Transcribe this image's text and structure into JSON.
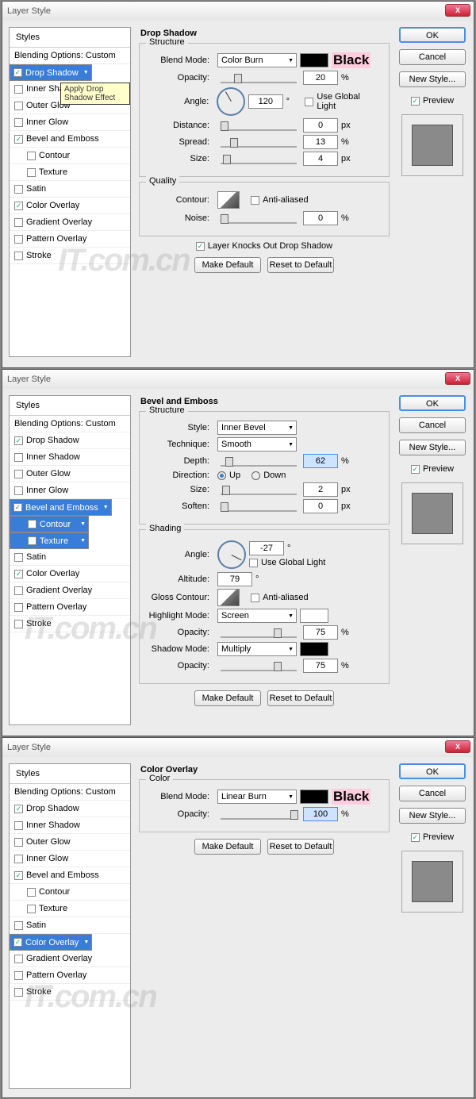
{
  "common": {
    "title": "Layer Style",
    "stylesHeader": "Styles",
    "blending": "Blending Options: Custom",
    "ok": "OK",
    "cancel": "Cancel",
    "newStyle": "New Style...",
    "preview": "Preview",
    "makeDefault": "Make Default",
    "resetDefault": "Reset to Default",
    "close": "X"
  },
  "styleList": [
    {
      "label": "Drop Shadow",
      "chk": true
    },
    {
      "label": "Inner Shadow",
      "chk": false
    },
    {
      "label": "Outer Glow",
      "chk": false
    },
    {
      "label": "Inner Glow",
      "chk": false
    },
    {
      "label": "Bevel and Emboss",
      "chk": true
    },
    {
      "label": "Contour",
      "chk": false,
      "sub": true
    },
    {
      "label": "Texture",
      "chk": false,
      "sub": true
    },
    {
      "label": "Satin",
      "chk": false
    },
    {
      "label": "Color Overlay",
      "chk": true
    },
    {
      "label": "Gradient Overlay",
      "chk": false
    },
    {
      "label": "Pattern Overlay",
      "chk": false
    },
    {
      "label": "Stroke",
      "chk": false
    }
  ],
  "d1": {
    "title": "Drop Shadow",
    "struct": "Structure",
    "quality": "Quality",
    "blendMode": "Blend Mode:",
    "blendVal": "Color Burn",
    "colorTag": "Black",
    "opacity": "Opacity:",
    "opacityVal": "20",
    "angle": "Angle:",
    "angleVal": "120",
    "globalLight": "Use Global Light",
    "distance": "Distance:",
    "distanceVal": "0",
    "spread": "Spread:",
    "spreadVal": "13",
    "size": "Size:",
    "sizeVal": "4",
    "contour": "Contour:",
    "antiAliased": "Anti-aliased",
    "noise": "Noise:",
    "noiseVal": "0",
    "knockout": "Layer Knocks Out Drop Shadow",
    "tooltip": "Apply Drop Shadow Effect",
    "px": "px",
    "pct": "%",
    "deg": "°"
  },
  "d2": {
    "title": "Bevel and Emboss",
    "struct": "Structure",
    "shading": "Shading",
    "style": "Style:",
    "styleVal": "Inner Bevel",
    "technique": "Technique:",
    "techniqueVal": "Smooth",
    "depth": "Depth:",
    "depthVal": "62",
    "direction": "Direction:",
    "up": "Up",
    "down": "Down",
    "size": "Size:",
    "sizeVal": "2",
    "soften": "Soften:",
    "softenVal": "0",
    "angle": "Angle:",
    "angleVal": "-27",
    "globalLight": "Use Global Light",
    "altitude": "Altitude:",
    "altitudeVal": "79",
    "contour": "Gloss Contour:",
    "antiAliased": "Anti-aliased",
    "hlMode": "Highlight Mode:",
    "hlVal": "Screen",
    "hlOp": "Opacity:",
    "hlOpVal": "75",
    "shMode": "Shadow Mode:",
    "shVal": "Multiply",
    "shOp": "Opacity:",
    "shOpVal": "75",
    "px": "px",
    "pct": "%",
    "deg": "°"
  },
  "d3": {
    "title": "Color Overlay",
    "color": "Color",
    "blendMode": "Blend Mode:",
    "blendVal": "Linear Burn",
    "colorTag": "Black",
    "opacity": "Opacity:",
    "opacityVal": "100",
    "pct": "%"
  },
  "wm": "IT.com.cn"
}
